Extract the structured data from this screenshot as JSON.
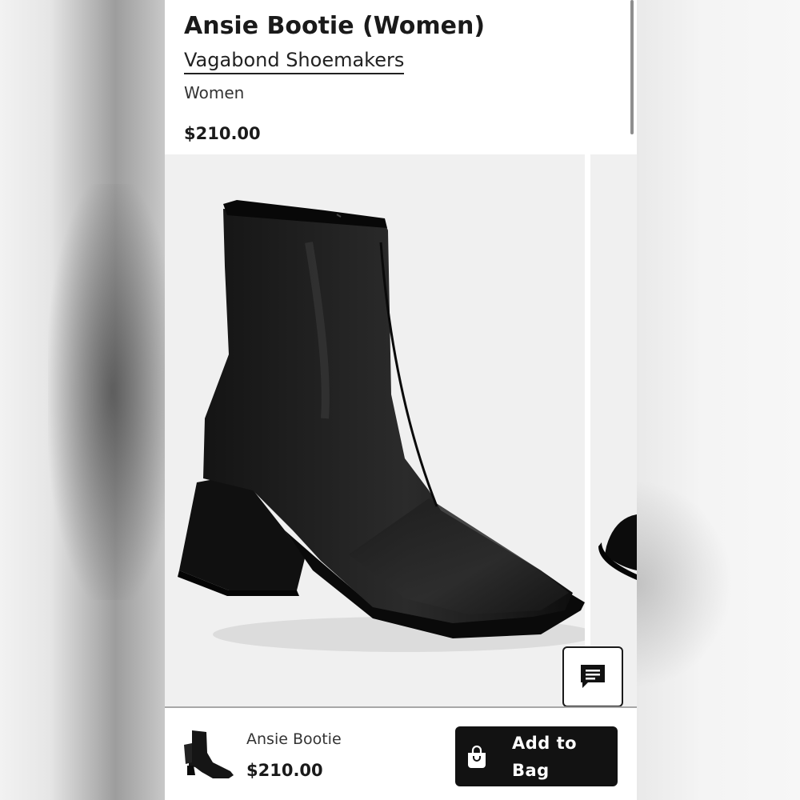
{
  "product": {
    "title": "Ansie Bootie (Women)",
    "brand": "Vagabond Shoemakers",
    "department": "Women",
    "price": "$210.00"
  },
  "gallery": {
    "image_subject": "black-leather-block-heel-ankle-boot",
    "background_color": "#f0f0f0"
  },
  "chat": {
    "icon": "chat-icon"
  },
  "sticky_bar": {
    "name": "Ansie Bootie",
    "price": "$210.00",
    "add_to_bag_label": "Add to Bag",
    "bag_icon": "shopping-bag-icon"
  },
  "colors": {
    "primary_button": "#121212",
    "text": "#1a1a1a"
  }
}
